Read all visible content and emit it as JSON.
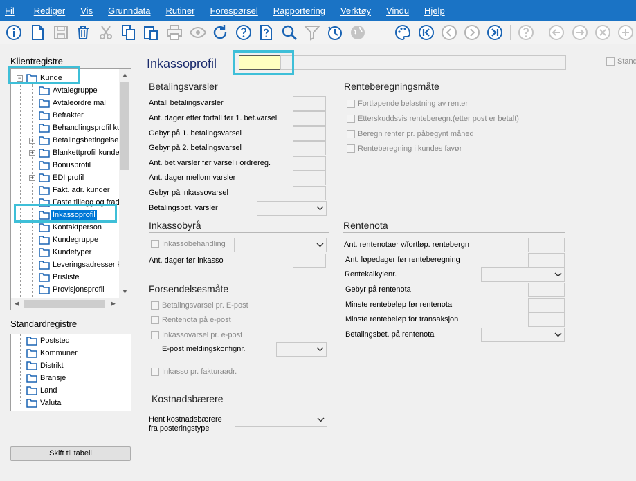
{
  "menu": [
    "Fil",
    "Rediger",
    "Vis",
    "Grunndata",
    "Rutiner",
    "Forespørsel",
    "Rapportering",
    "Verktøy",
    "Vindu",
    "Hjelp"
  ],
  "toolbar_icons": [
    "info-icon",
    "new-document-icon",
    "save-icon",
    "delete-icon",
    "cut-icon",
    "copy-icon",
    "paste-icon",
    "print-icon",
    "view-icon",
    "refresh-icon",
    "help-icon",
    "context-help-icon",
    "search-icon",
    "filter-icon",
    "history-icon",
    "globe-icon",
    "palette-icon",
    "first-record-icon",
    "previous-record-icon",
    "next-record-icon",
    "last-record-icon",
    "help-search-icon",
    "back-icon",
    "forward-icon",
    "cancel-icon",
    "add-icon"
  ],
  "sidebar": {
    "client_label": "Klientregistre",
    "client_tree": {
      "root": "Kunde",
      "children": [
        "Avtalegruppe",
        "Avtaleordre mal",
        "Befrakter",
        "Behandlingsprofil ku",
        "Betalingsbetingelse",
        "Blankettprofil kunde",
        "Bonusprofil",
        "EDI profil",
        "Fakt. adr. kunder",
        "Faste tillegg og frad",
        "Inkassoprofil",
        "Kontaktperson",
        "Kundegruppe",
        "Kundetyper",
        "Leveringsadresser k",
        "Prisliste",
        "Provisjonsprofil"
      ],
      "selected": "Inkassoprofil"
    },
    "standard_label": "Standardregistre",
    "standard_tree": [
      "Poststed",
      "Kommuner",
      "Distrikt",
      "Bransje",
      "Land",
      "Valuta"
    ],
    "switch_button": "Skift til tabell"
  },
  "form": {
    "title": "Inkassoprofil",
    "code_value": "",
    "description_value": "",
    "standard_checkbox": "Standard",
    "betalingsvarsler": {
      "title": "Betalingsvarsler",
      "fields": [
        "Antall betalingsvarsler",
        "Ant. dager etter forfall før 1. bet.varsel",
        "Gebyr på 1. betalingsvarsel",
        "Gebyr på 2. betalingsvarsel",
        "Ant. bet.varsler før varsel i ordrereg.",
        "Ant. dager mellom varsler",
        "Gebyr på inkassovarsel"
      ],
      "combo_label": "Betalingsbet. varsler"
    },
    "inkassobyraa": {
      "title": "Inkassobyrå",
      "checkbox": "Inkassobehandling",
      "field": "Ant. dager før inkasso"
    },
    "forsendelsesmaate": {
      "title": "Forsendelsesmåte",
      "checkboxes": [
        "Betalingsvarsel pr. E-post",
        "Rentenota på e-post",
        "Inkassovarsel pr. e-post"
      ],
      "combo_label": "E-post meldingskonfignr.",
      "checkbox_bottom": "Inkasso pr. fakturaadr."
    },
    "kostnadsbaerere": {
      "title": "Kostnadsbærere",
      "label_line1": "Hent kostnadsbærere",
      "label_line2": "fra posteringstype"
    },
    "renteberegningsmaate": {
      "title": "Renteberegningsmåte",
      "checkboxes": [
        "Fortløpende belastning av renter",
        "Etterskuddsvis renteberegn.(etter post er betalt)",
        "Beregn renter pr. påbegynt måned",
        "Renteberegning i kundes favør"
      ]
    },
    "rentenota": {
      "title": "Rentenota",
      "fields": [
        "Ant. rentenotaer v/fortløp. rentebergn",
        "Ant. løpedager før renteberegning",
        "Rentekalkylenr.",
        "Gebyr på rentenota",
        "Minste rentebeløp før rentenota",
        "Minste rentebeløp for transaksjon",
        "Betalingsbet. på rentenota"
      ]
    }
  },
  "colors": {
    "menubar": "#1a73c5",
    "toolbar_icon": "#1a64b4",
    "highlight": "#3ebfd8",
    "input_active": "#ffffc0",
    "title": "#1a2a6c"
  }
}
